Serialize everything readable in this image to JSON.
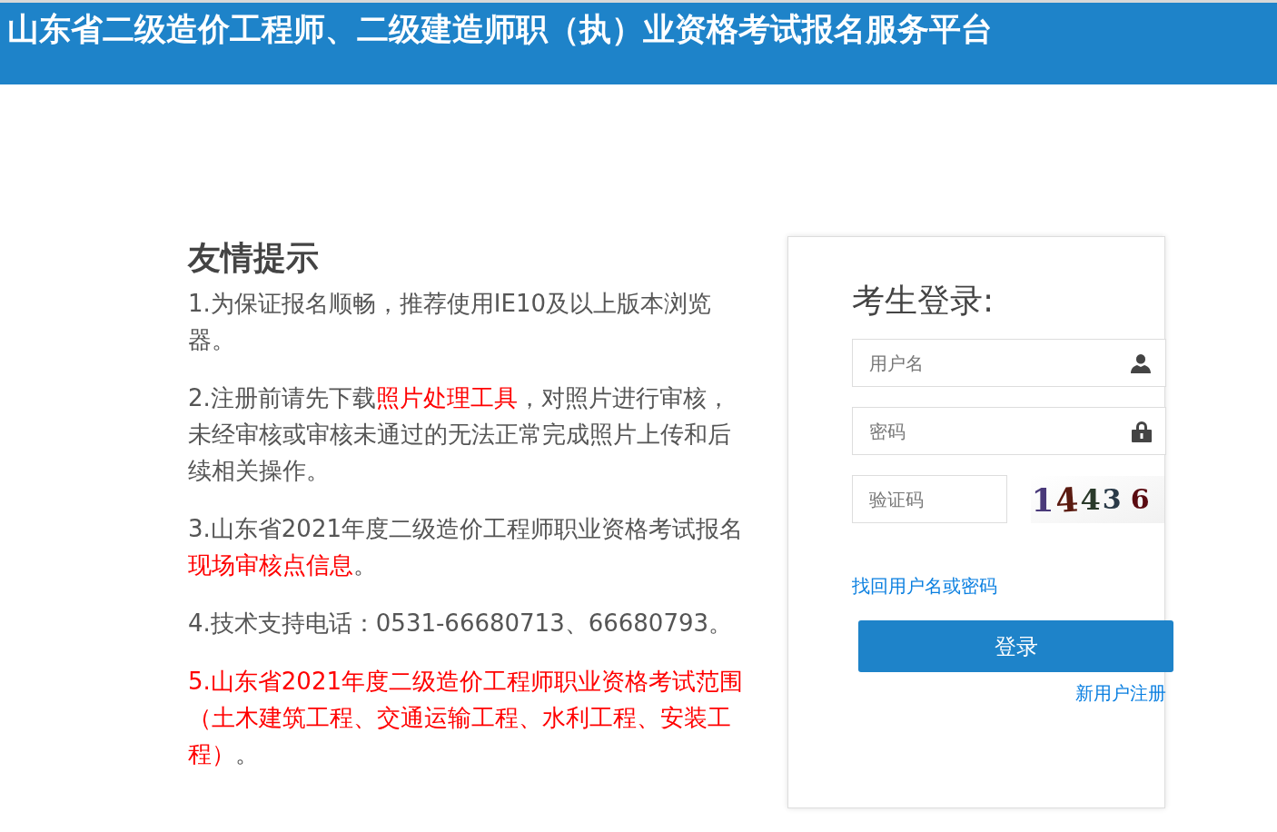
{
  "header": {
    "title": "山东省二级造价工程师、二级建造师职（执）业资格考试报名服务平台"
  },
  "notices": {
    "heading": "友情提示",
    "items": [
      {
        "segments": [
          {
            "kind": "plain",
            "text": "1.为保证报名顺畅，推荐使用IE10及以上版本浏览器。"
          }
        ]
      },
      {
        "segments": [
          {
            "kind": "plain",
            "text": "2.注册前请先下载"
          },
          {
            "kind": "link",
            "text": "照片处理工具"
          },
          {
            "kind": "plain",
            "text": "，对照片进行审核，未经审核或审核未通过的无法正常完成照片上传和后续相关操作。"
          }
        ]
      },
      {
        "segments": [
          {
            "kind": "plain",
            "text": "3.山东省2021年度二级造价工程师职业资格考试报名"
          },
          {
            "kind": "link",
            "text": "现场审核点信息"
          },
          {
            "kind": "plain",
            "text": "。"
          }
        ]
      },
      {
        "segments": [
          {
            "kind": "plain",
            "text": "4.技术支持电话：0531-66680713、66680793。"
          }
        ]
      },
      {
        "segments": [
          {
            "kind": "emphasis",
            "text": "5.山东省2021年度二级造价工程师职业资格考试范围（土木建筑工程、交通运输工程、水利工程、安装工程）"
          },
          {
            "kind": "plain",
            "text": "。"
          }
        ]
      }
    ]
  },
  "login": {
    "title": "考生登录:",
    "username": {
      "placeholder": "用户名"
    },
    "password": {
      "placeholder": "密码"
    },
    "captcha": {
      "placeholder": "验证码",
      "code": "14436"
    },
    "recover_link": "找回用户名或密码",
    "submit": "登录",
    "register_link": "新用户注册"
  }
}
